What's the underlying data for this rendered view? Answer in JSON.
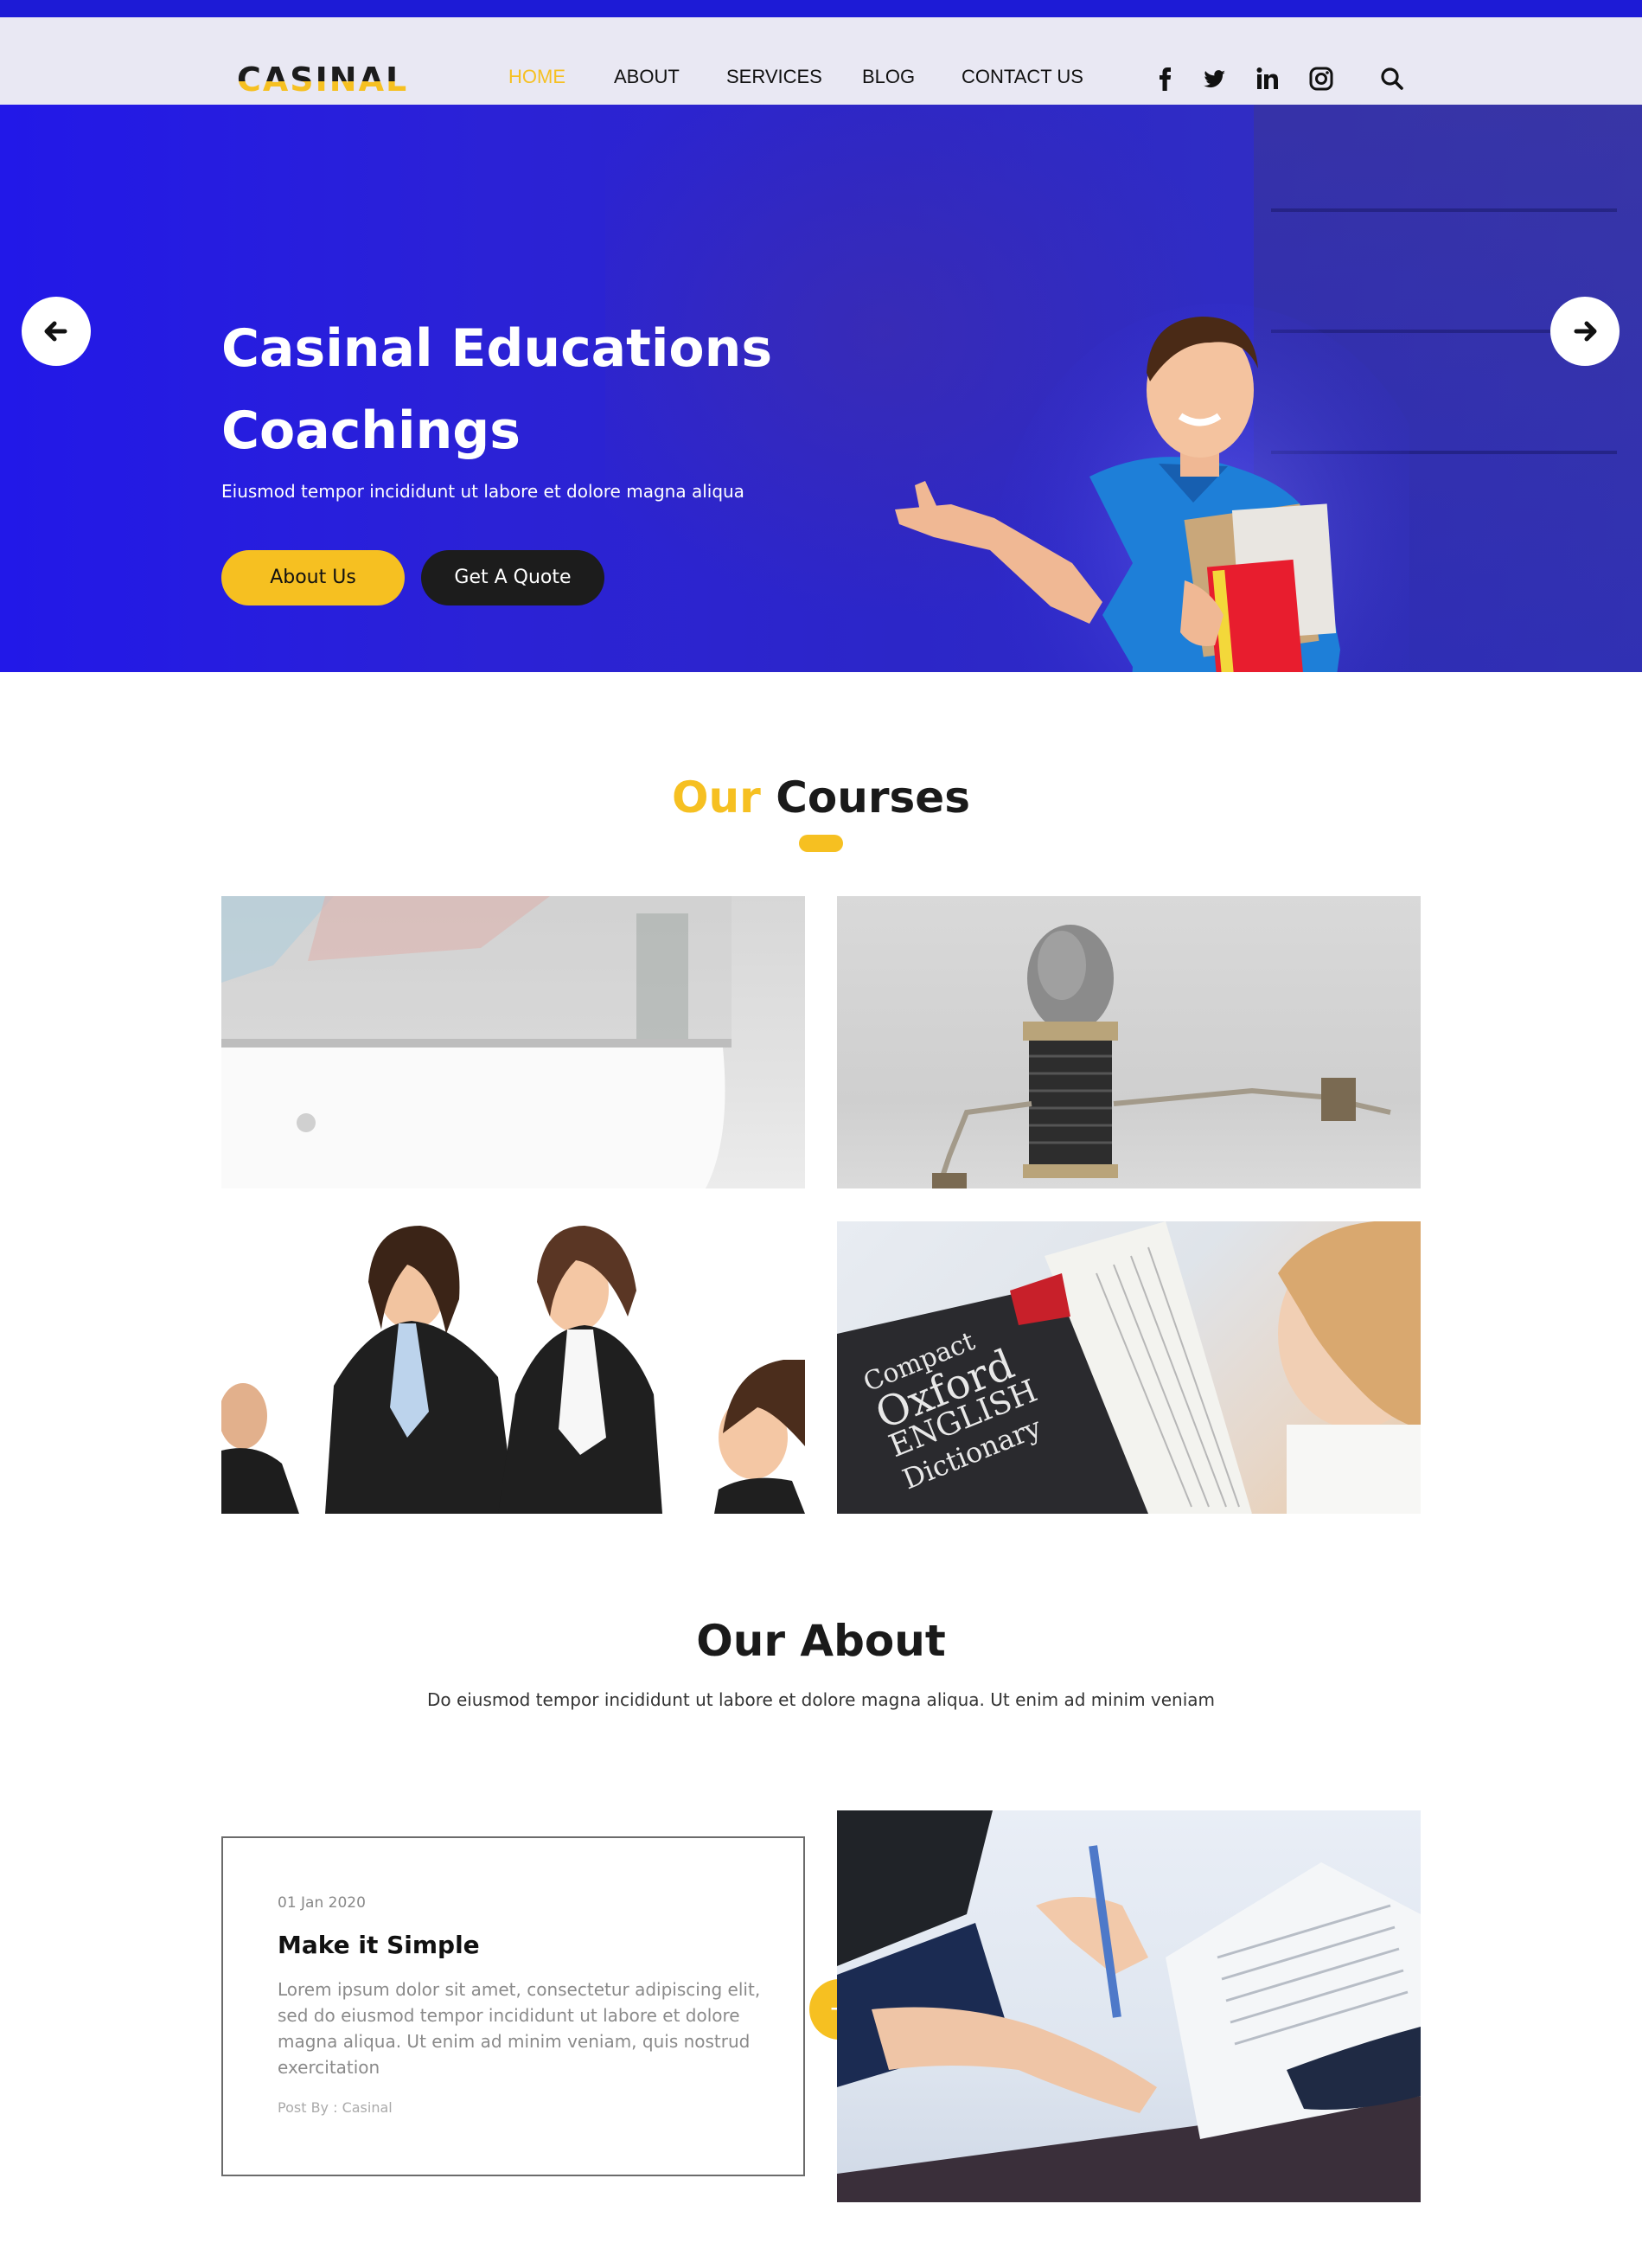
{
  "brand": {
    "logo_text": "CASINAL",
    "accent_color": "#f6c021",
    "primary_color": "#1d1bd6"
  },
  "nav": {
    "items": [
      {
        "label": "HOME",
        "active": true
      },
      {
        "label": "ABOUT",
        "active": false
      },
      {
        "label": "SERVICES",
        "active": false
      },
      {
        "label": "BLOG",
        "active": false
      },
      {
        "label": "CONTACT US",
        "active": false
      }
    ],
    "social_icons": [
      "facebook-icon",
      "twitter-icon",
      "linkedin-icon",
      "instagram-icon"
    ],
    "search_icon": "search-icon"
  },
  "hero": {
    "title_line1": "Casinal Educations",
    "title_line2": "Coachings",
    "subtitle": "Eiusmod tempor incididunt ut labore et dolore magna aliqua",
    "primary_button": "About Us",
    "secondary_button": "Get A Quote",
    "prev_icon": "arrow-left-icon",
    "next_icon": "arrow-right-icon"
  },
  "courses": {
    "title_accent": "Our",
    "title_rest": "Courses"
  },
  "about": {
    "title": "Our About",
    "subtitle": "Do eiusmod tempor incididunt ut labore et dolore magna aliqua. Ut enim ad minim veniam"
  },
  "post": {
    "date": "01 Jan 2020",
    "title": "Make it Simple",
    "body": "Lorem ipsum dolor sit amet, consectetur adipiscing elit, sed do eiusmod tempor incididunt ut labore et dolore magna aliqua. Ut enim ad minim veniam, quis nostrud exercitation",
    "byline": "Post By : Casinal",
    "plus_label": "+"
  },
  "book": {
    "line1": "Compact",
    "line2": "Oxford",
    "line3": "ENGLISH",
    "line4": "Dictionary"
  }
}
